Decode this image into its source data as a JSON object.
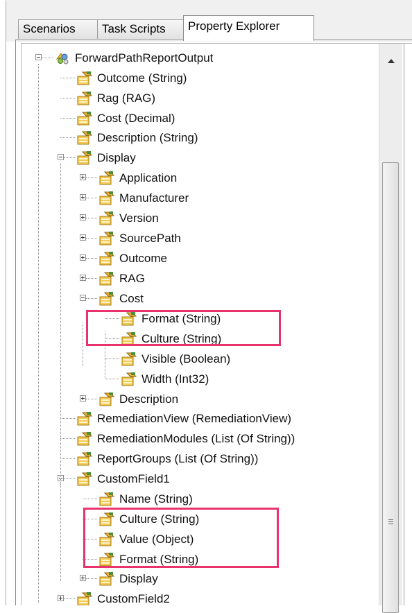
{
  "tabs": [
    {
      "label": "Scenarios",
      "active": false
    },
    {
      "label": "Task Scripts",
      "active": false
    },
    {
      "label": "Property Explorer",
      "active": true
    }
  ],
  "tree": {
    "nodes": [
      {
        "label": "ForwardPathReportOutput",
        "icon": "class-icon",
        "expander": "minus"
      },
      {
        "label": "Outcome (String)",
        "icon": "property-icon"
      },
      {
        "label": "Rag (RAG)",
        "icon": "property-icon"
      },
      {
        "label": "Cost (Decimal)",
        "icon": "property-icon"
      },
      {
        "label": "Description (String)",
        "icon": "property-icon"
      },
      {
        "label": "Display",
        "icon": "property-icon",
        "expander": "minus"
      },
      {
        "label": "Application",
        "icon": "property-icon",
        "expander": "plus"
      },
      {
        "label": "Manufacturer",
        "icon": "property-icon",
        "expander": "plus"
      },
      {
        "label": "Version",
        "icon": "property-icon",
        "expander": "plus"
      },
      {
        "label": "SourcePath",
        "icon": "property-icon",
        "expander": "plus"
      },
      {
        "label": "Outcome",
        "icon": "property-icon",
        "expander": "plus"
      },
      {
        "label": "RAG",
        "icon": "property-icon",
        "expander": "plus"
      },
      {
        "label": "Cost",
        "icon": "property-icon",
        "expander": "minus"
      },
      {
        "label": "Format (String)",
        "icon": "property-icon"
      },
      {
        "label": "Culture (String)",
        "icon": "property-icon"
      },
      {
        "label": "Visible (Boolean)",
        "icon": "property-icon"
      },
      {
        "label": "Width (Int32)",
        "icon": "property-icon"
      },
      {
        "label": "Description",
        "icon": "property-icon",
        "expander": "plus"
      },
      {
        "label": "RemediationView (RemediationView)",
        "icon": "property-icon"
      },
      {
        "label": "RemediationModules (List (Of String))",
        "icon": "property-icon"
      },
      {
        "label": "ReportGroups (List (Of String))",
        "icon": "property-icon"
      },
      {
        "label": "CustomField1",
        "icon": "property-icon",
        "expander": "minus"
      },
      {
        "label": "Name (String)",
        "icon": "property-icon"
      },
      {
        "label": "Culture (String)",
        "icon": "property-icon"
      },
      {
        "label": "Value (Object)",
        "icon": "property-icon"
      },
      {
        "label": "Format (String)",
        "icon": "property-icon"
      },
      {
        "label": "Display",
        "icon": "property-icon",
        "expander": "plus"
      },
      {
        "label": "CustomField2",
        "icon": "property-icon",
        "expander": "plus"
      }
    ]
  },
  "scrollbar": {
    "up_icon": "scroll-up-arrow-icon",
    "thumb_grip_icon": "grip-icon"
  },
  "colors": {
    "highlight": "#e8336d",
    "property_icon_body": "#f3c95a",
    "class_icon_accent": "#6aa0d8"
  }
}
